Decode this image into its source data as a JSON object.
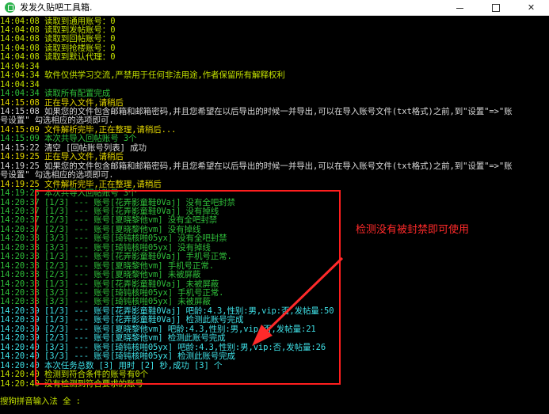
{
  "window": {
    "title": "发发久贴吧工具箱.",
    "minimize_label": "",
    "maximize_label": "",
    "close_label": "✕"
  },
  "console_lines": [
    {
      "text": "14:04:08 读取到通用账号：0",
      "color": "lime"
    },
    {
      "text": "14:04:08 读取到发帖账号：0",
      "color": "lime"
    },
    {
      "text": "14:04:08 读取到回帖账号：0",
      "color": "lime"
    },
    {
      "text": "14:04:08 读取到抢楼账号：0",
      "color": "lime"
    },
    {
      "text": "14:04:08 读取到默认代理：0",
      "color": "lime"
    },
    {
      "text": "14:04:34",
      "color": "lime"
    },
    {
      "text": "14:04:34 软件仅供学习交流,严禁用于任何非法用途,作者保留所有解释权利",
      "color": "lime"
    },
    {
      "text": "14:04:34",
      "color": "lime"
    },
    {
      "text": "14:04:34 读取所有配置完成",
      "color": "green"
    },
    {
      "text": "14:15:08 正在导入文件,请稍后",
      "color": "yellow"
    },
    {
      "text": "14:15:08 如果您的文件包含邮箱和邮箱密码,并且您希望在以后导出的时候一并导出,可以在导入账号文件(txt格式)之前,到\"设置\"=>\"账",
      "color": "white"
    },
    {
      "text": "号设置\" 勾选相应的选项即可.",
      "color": "white"
    },
    {
      "text": "14:15:09 文件解析完毕,正在整理,请稍后...",
      "color": "yellow"
    },
    {
      "text": "14:15:09 本次共导入回帖账号 3个",
      "color": "green"
    },
    {
      "text": "14:15:22 清空 [回帖账号列表] 成功",
      "color": "white"
    },
    {
      "text": "14:19:25 正在导入文件,请稍后",
      "color": "yellow"
    },
    {
      "text": "14:19:25 如果您的文件包含邮箱和邮箱密码,并且您希望在以后导出的时候一并导出,可以在导入账号文件(txt格式)之前,到\"设置\"=>\"账",
      "color": "white"
    },
    {
      "text": "号设置\" 勾选相应的选项即可.",
      "color": "white"
    },
    {
      "text": "14:19:25 文件解析完毕,正在整理,请稍后",
      "color": "yellow"
    },
    {
      "text": "14:19:25 本次共导入回帖账号 3个",
      "color": "green"
    },
    {
      "text": "14:20:37 [1/3] --- 账号[花弄影童鞋0Vaj] 没有全吧封禁",
      "color": "green"
    },
    {
      "text": "14:20:37 [1/3] --- 账号[花弄影童鞋0Vaj] 没有掉线",
      "color": "green"
    },
    {
      "text": "14:20:37 [2/3] --- 账号[夏晓黎他vm] 没有全吧封禁",
      "color": "green"
    },
    {
      "text": "14:20:37 [2/3] --- 账号[夏晓黎他vm] 没有掉线",
      "color": "green"
    },
    {
      "text": "14:20:38 [3/3] --- 账号[琦钝核啪05yx] 没有全吧封禁",
      "color": "green"
    },
    {
      "text": "14:20:38 [3/3] --- 账号[琦钝核啪05yx] 没有掉线",
      "color": "green"
    },
    {
      "text": "14:20:38 [1/3] --- 账号[花弄影童鞋0Vaj] 手机号正常.",
      "color": "green"
    },
    {
      "text": "14:20:38 [2/3] --- 账号[夏晓黎他vm] 手机号正常.",
      "color": "green"
    },
    {
      "text": "14:20:38 [2/3] --- 账号[夏晓黎他vm] 未被屏蔽",
      "color": "green"
    },
    {
      "text": "14:20:38 [1/3] --- 账号[花弄影童鞋0Vaj] 未被屏蔽",
      "color": "green"
    },
    {
      "text": "14:20:38 [3/3] --- 账号[琦钝核啪05yx] 手机号正常.",
      "color": "green"
    },
    {
      "text": "14:20:38 [3/3] --- 账号[琦钝核啪05yx] 未被屏蔽",
      "color": "green"
    },
    {
      "text": "14:20:39 [1/3] --- 账号[花弄影童鞋0Vaj] 吧龄:4.3,性别:男,vip:否,发帖量:50",
      "color": "cyan"
    },
    {
      "text": "14:20:39 [1/3] --- 账号[花弄影童鞋0Vaj] 检测此账号完成",
      "color": "cyan"
    },
    {
      "text": "14:20:39 [2/3] --- 账号[夏晓黎他vm] 吧龄:4.3,性别:男,vip:否,发帖量:21",
      "color": "cyan"
    },
    {
      "text": "14:20:39 [2/3] --- 账号[夏晓黎他vm] 检测此账号完成",
      "color": "cyan"
    },
    {
      "text": "14:20:40 [3/3] --- 账号[琦钝核啪05yx] 吧龄:4.3,性别:男,vip:否,发帖量:26",
      "color": "cyan"
    },
    {
      "text": "14:20:40 [3/3] --- 账号[琦钝核啪05yx] 检测此账号完成",
      "color": "cyan"
    },
    {
      "text": "14:20:40 本次任务总数 [3] 用时 [2] 秒,成功 [3] 个",
      "color": "cyan"
    },
    {
      "text": "14:20:40 检测到符合条件的账号有0个",
      "color": "lime"
    },
    {
      "text": "14:20:40 没有检测到符合要求的账号",
      "color": "lime"
    },
    {
      "text": "",
      "color": "lime"
    },
    {
      "text": "搜狗拼音输入法 全 :",
      "color": "lime"
    }
  ],
  "annotation": {
    "text": "检测没有被封禁即可使用",
    "color": "#ff2a2a"
  },
  "colors": {
    "background": "#000000",
    "lime": "#c3e000",
    "green": "#2fbf3a",
    "white": "#d8d8d8",
    "cyan": "#3fe0e6",
    "yellow": "#e5d800",
    "highlight_box": "#ff1e1e"
  }
}
